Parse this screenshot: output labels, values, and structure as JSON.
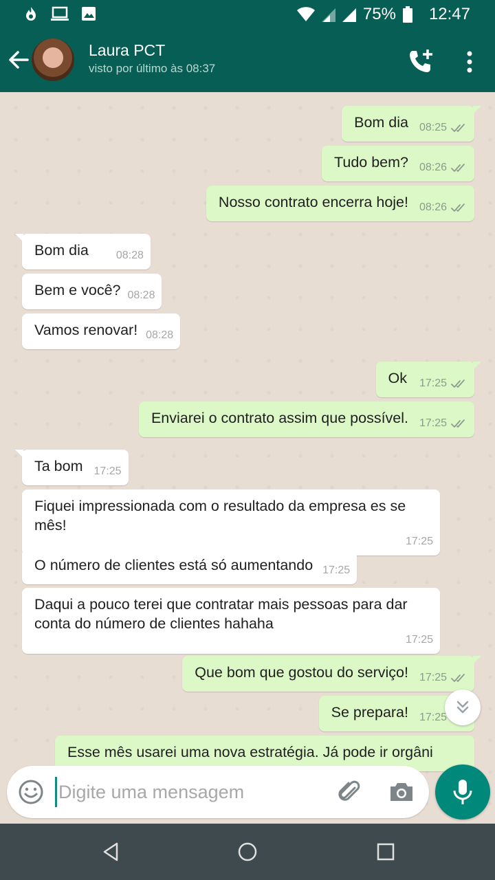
{
  "status_bar": {
    "battery": "75%",
    "time": "12:47"
  },
  "header": {
    "contact_name": "Laura PCT",
    "last_seen": "visto por último às 08:37"
  },
  "messages": [
    {
      "text": "Bom dia",
      "time": "08:25",
      "direction": "out"
    },
    {
      "text": "Tudo bem?",
      "time": "08:26",
      "direction": "out"
    },
    {
      "text": "Nosso contrato encerra hoje!",
      "time": "08:26",
      "direction": "out"
    },
    {
      "text": "Bom dia",
      "time": "08:28",
      "direction": "in"
    },
    {
      "text": "Bem e você?",
      "time": "08:28",
      "direction": "in"
    },
    {
      "text": "Vamos renovar!",
      "time": "08:28",
      "direction": "in"
    },
    {
      "text": "Ok",
      "time": "17:25",
      "direction": "out"
    },
    {
      "text": "Enviarei o contrato assim que possível.",
      "time": "17:25",
      "direction": "out"
    },
    {
      "text": "Ta bom",
      "time": "17:25",
      "direction": "in"
    },
    {
      "text": "Fiquei impressionada com o resultado da empresa es se mês!",
      "time": "17:25",
      "direction": "in"
    },
    {
      "text": "O número de clientes está só aumentando",
      "time": "17:25",
      "direction": "in"
    },
    {
      "text": "Daqui a pouco terei que contratar mais pessoas para dar conta do número de clientes hahaha",
      "time": "17:25",
      "direction": "in"
    },
    {
      "text": "Que bom que gostou do serviço!",
      "time": "17:25",
      "direction": "out"
    },
    {
      "text": "Se prepara!",
      "time": "17:25",
      "direction": "out"
    },
    {
      "text": "Esse mês usarei uma nova estratégia. Já pode ir orgâni",
      "time": "",
      "direction": "out"
    }
  ],
  "input": {
    "placeholder": "Digite uma mensagem",
    "value": ""
  },
  "colors": {
    "header": "#075e54",
    "outgoing_bubble": "#dcf8c6",
    "incoming_bubble": "#ffffff",
    "accent": "#00897b",
    "read_ticks": "#8e9a8e"
  },
  "icons": [
    "fire-icon",
    "screen-icon",
    "image-icon",
    "wifi-icon",
    "signal-icon",
    "battery-icon",
    "back-arrow-icon",
    "add-call-icon",
    "more-vert-icon",
    "double-check-icon",
    "scroll-down-icon",
    "emoji-icon",
    "attach-icon",
    "camera-icon",
    "mic-icon",
    "nav-back-icon",
    "nav-home-icon",
    "nav-recent-icon"
  ]
}
